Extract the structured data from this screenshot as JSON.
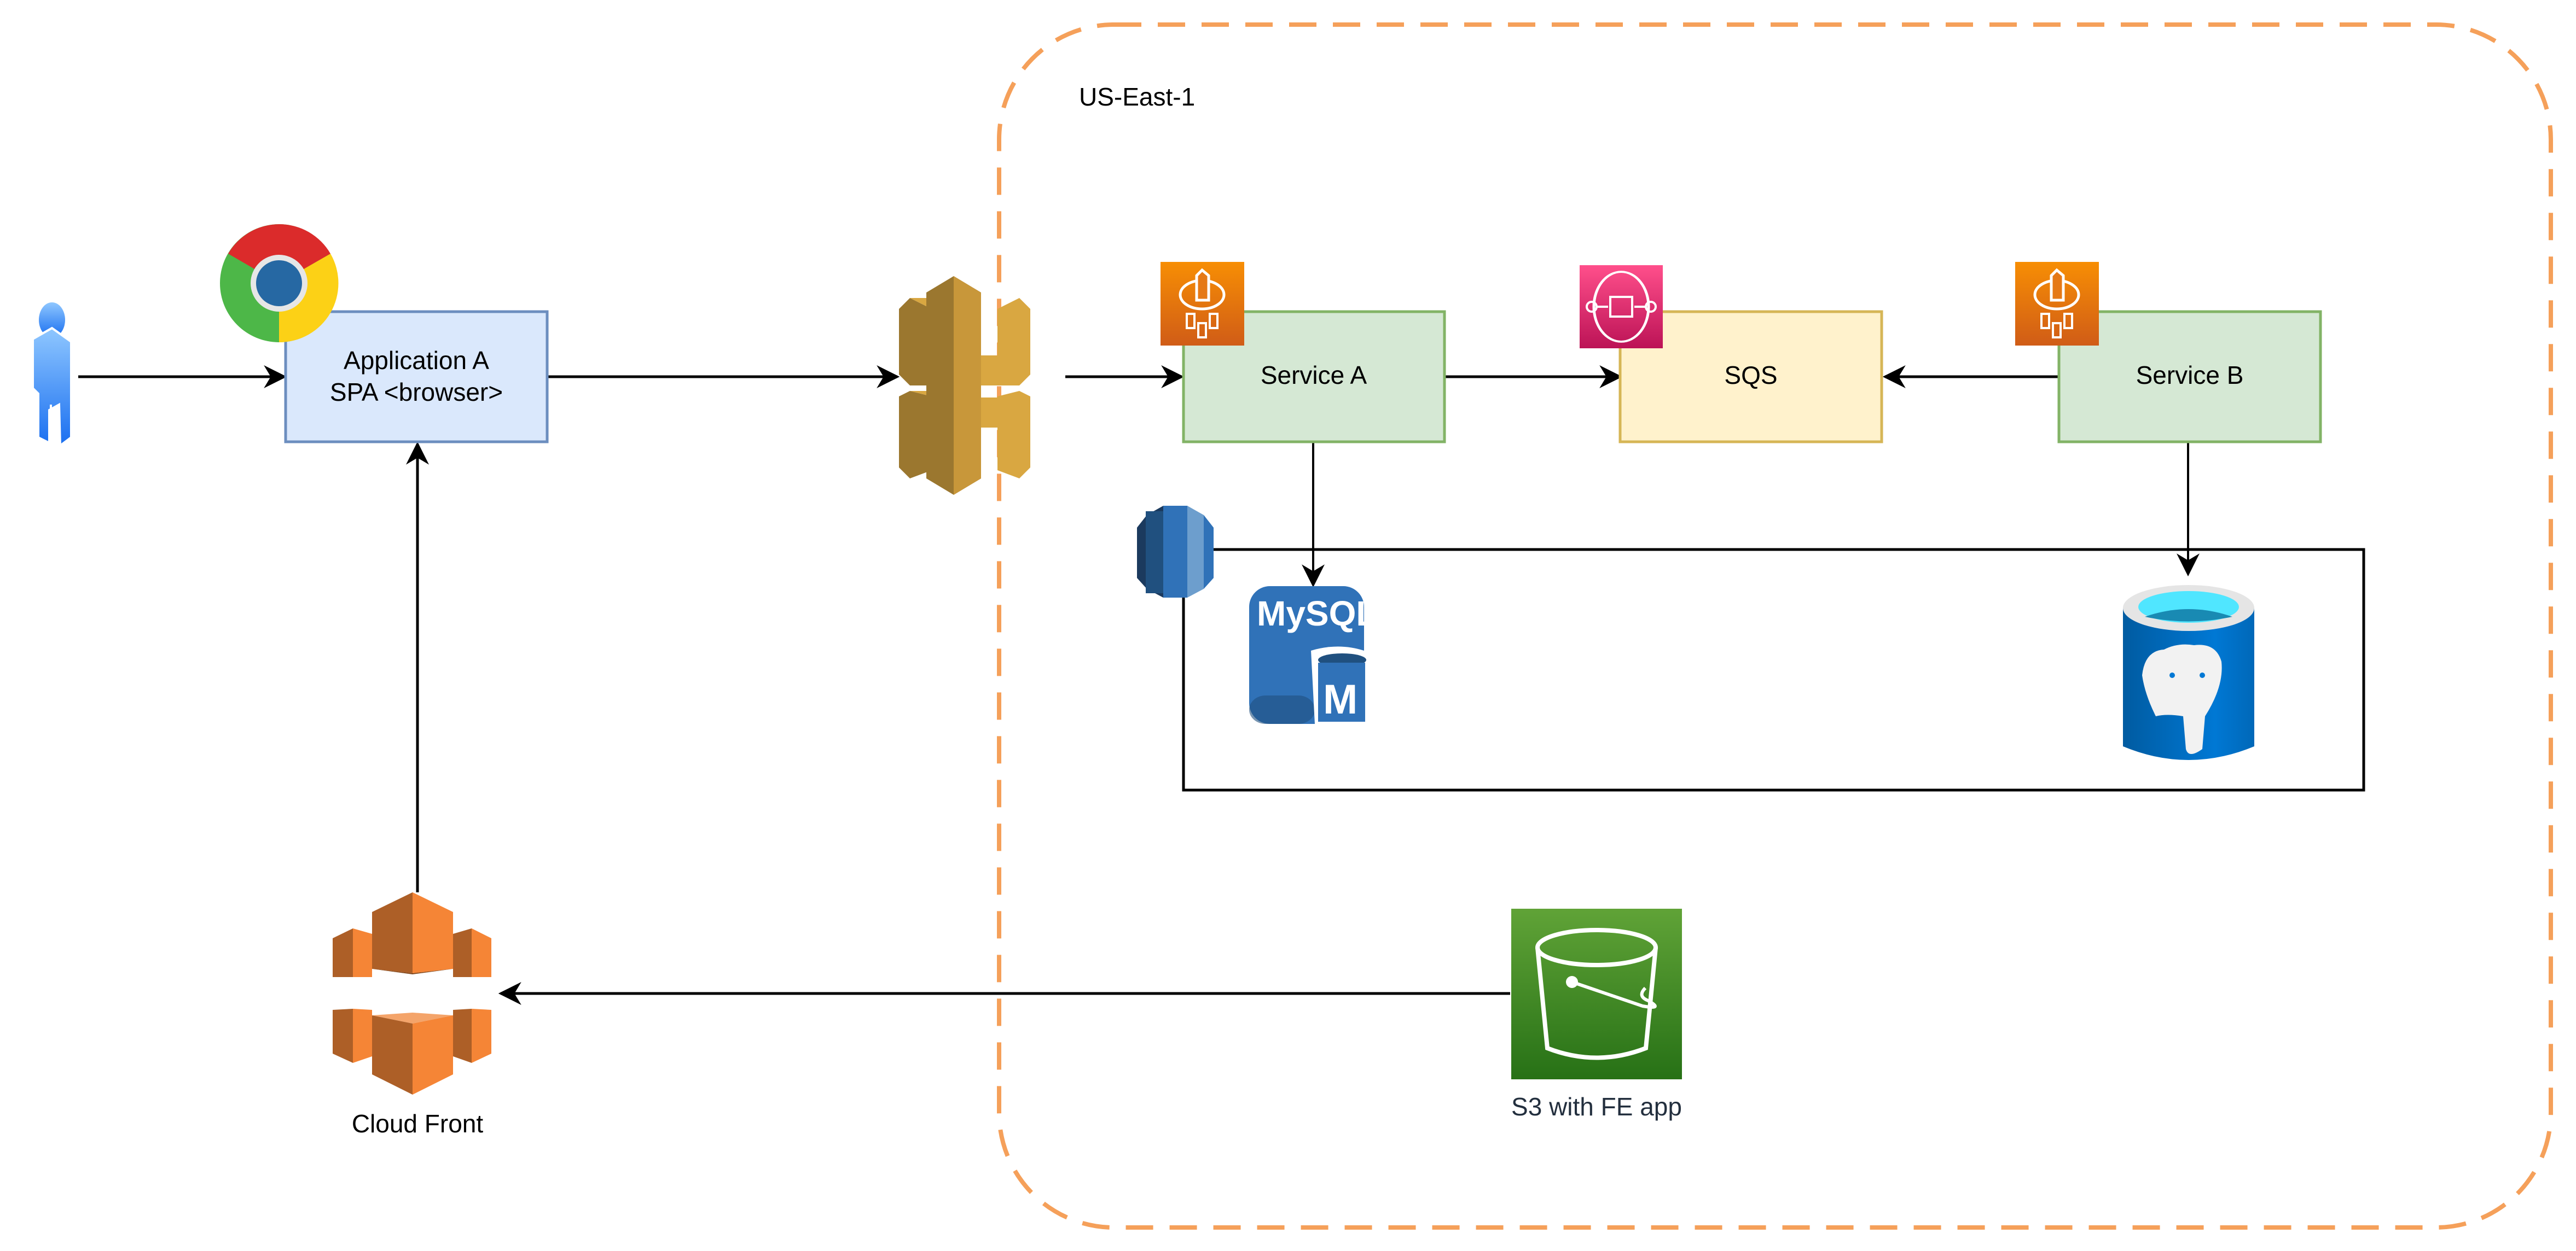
{
  "region": {
    "label": "US-East-1",
    "border_color": "#f5a05a"
  },
  "nodes": {
    "user": {
      "icon": "user-icon"
    },
    "app_a": {
      "line1": "Application A",
      "line2": "SPA <browser>",
      "fill": "#dae8fc",
      "stroke": "#6c8ebf",
      "badge_icon": "chrome-icon"
    },
    "api_gateway": {
      "icon": "api-gateway-icon"
    },
    "service_a": {
      "label": "Service A",
      "fill": "#d5e8d4",
      "stroke": "#82b366",
      "badge_icon": "fargate-icon"
    },
    "sqs": {
      "label": "SQS",
      "fill": "#fff2cc",
      "stroke": "#d6b656",
      "badge_icon": "sqs-icon"
    },
    "service_b": {
      "label": "Service B",
      "fill": "#d5e8d4",
      "stroke": "#82b366",
      "badge_icon": "fargate-icon"
    },
    "rds_group": {
      "icon": "rds-icon"
    },
    "mysql": {
      "title": "MySQL",
      "letter": "M",
      "icon": "mysql-icon"
    },
    "postgres": {
      "icon": "postgresql-icon"
    },
    "cloudfront": {
      "label": "Cloud Front",
      "icon": "cloudfront-icon"
    },
    "s3": {
      "label": "S3 with FE app",
      "icon": "s3-bucket-icon"
    }
  },
  "edges": [
    {
      "from": "user",
      "to": "app_a"
    },
    {
      "from": "app_a",
      "to": "api_gateway"
    },
    {
      "from": "api_gateway",
      "to": "service_a"
    },
    {
      "from": "service_a",
      "to": "sqs"
    },
    {
      "from": "service_b",
      "to": "sqs"
    },
    {
      "from": "service_a",
      "to": "mysql"
    },
    {
      "from": "service_b",
      "to": "postgres"
    },
    {
      "from": "cloudfront",
      "to": "app_a"
    },
    {
      "from": "s3",
      "to": "cloudfront"
    }
  ]
}
